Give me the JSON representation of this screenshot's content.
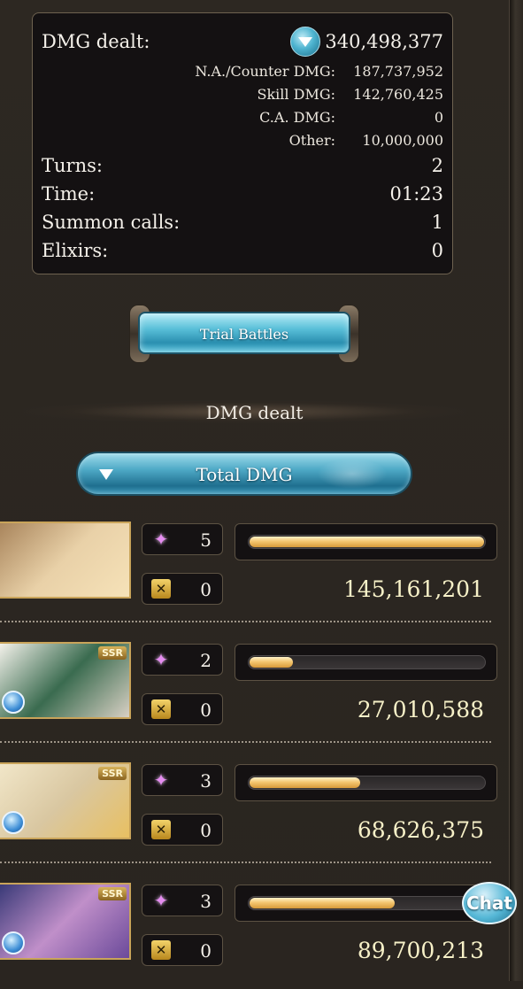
{
  "summary": {
    "dmg_dealt_label": "DMG dealt:",
    "dmg_dealt_value": "340,498,377",
    "breakdown": [
      {
        "label": "N.A./Counter DMG:",
        "value": "187,737,952"
      },
      {
        "label": "Skill DMG:",
        "value": "142,760,425"
      },
      {
        "label": "C.A. DMG:",
        "value": "0"
      },
      {
        "label": "Other:",
        "value": "10,000,000"
      }
    ],
    "stats": [
      {
        "label": "Turns:",
        "value": "2"
      },
      {
        "label": "Time:",
        "value": "01:23"
      },
      {
        "label": "Summon calls:",
        "value": "1"
      },
      {
        "label": "Elixirs:",
        "value": "0"
      }
    ]
  },
  "trial_button": {
    "label": "Trial Battles"
  },
  "section": {
    "title": "DMG dealt"
  },
  "sort_dropdown": {
    "selected": "Total DMG"
  },
  "characters": [
    {
      "ssr": "",
      "skill_count": "5",
      "ca_count": "0",
      "damage": "145,161,201",
      "share": 1.0,
      "has_element": false,
      "art": [
        "#a9855c",
        "#e9d1a8",
        "#f6e2b8"
      ]
    },
    {
      "ssr": "SSR",
      "skill_count": "2",
      "ca_count": "0",
      "damage": "27,010,588",
      "share": 0.186,
      "has_element": true,
      "art": [
        "#f3f1ea",
        "#3a6b4f",
        "#d8d0c4"
      ]
    },
    {
      "ssr": "SSR",
      "skill_count": "3",
      "ca_count": "0",
      "damage": "68,626,375",
      "share": 0.473,
      "has_element": true,
      "art": [
        "#f1e6c8",
        "#d9c7a1",
        "#e8c062"
      ]
    },
    {
      "ssr": "SSR",
      "skill_count": "3",
      "ca_count": "0",
      "damage": "89,700,213",
      "share": 0.618,
      "has_element": true,
      "art": [
        "#3a3a78",
        "#c08fc9",
        "#6b4a9a"
      ]
    }
  ],
  "chat_button": {
    "label": "Chat"
  },
  "colors": {
    "accent_blue": "#4eb4d0",
    "bar_gold": "#f4c670",
    "frame_gold": "#c9a45a"
  }
}
